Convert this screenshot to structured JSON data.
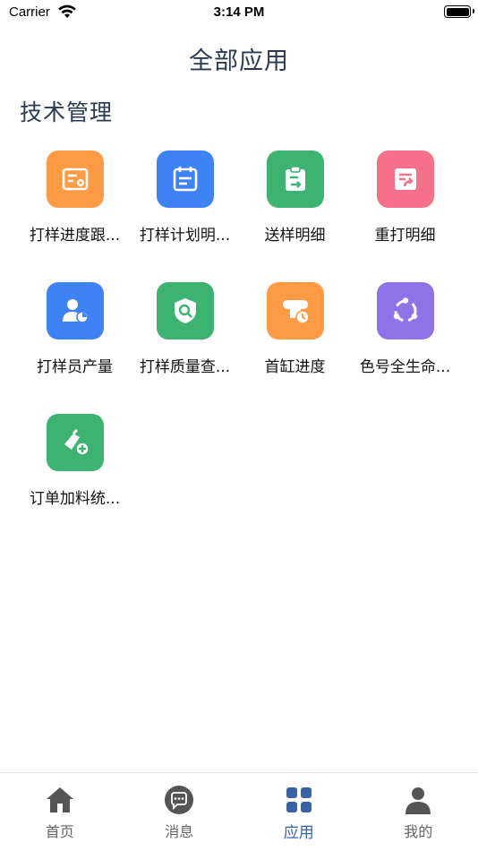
{
  "status_bar": {
    "carrier": "Carrier",
    "time": "3:14 PM"
  },
  "header": {
    "title": "全部应用"
  },
  "section": {
    "title": "技术管理"
  },
  "apps": [
    {
      "label": "打样进度跟...",
      "icon": "progress-tracking-icon",
      "color": "#FF9A45"
    },
    {
      "label": "打样计划明...",
      "icon": "calendar-plan-icon",
      "color": "#3E82F7"
    },
    {
      "label": "送样明细",
      "icon": "clipboard-send-icon",
      "color": "#3CB371"
    },
    {
      "label": "重打明细",
      "icon": "redo-document-icon",
      "color": "#F7708A"
    },
    {
      "label": "打样员产量",
      "icon": "user-chart-icon",
      "color": "#3E82F7"
    },
    {
      "label": "打样质量查...",
      "icon": "quality-search-icon",
      "color": "#3CB371"
    },
    {
      "label": "首缸进度",
      "icon": "vat-clock-icon",
      "color": "#FF9A45"
    },
    {
      "label": "色号全生命...",
      "icon": "lifecycle-icon",
      "color": "#8E72E8"
    },
    {
      "label": "订单加料统...",
      "icon": "add-material-icon",
      "color": "#3CB371"
    }
  ],
  "tabs": [
    {
      "label": "首页",
      "icon": "home-icon",
      "active": false
    },
    {
      "label": "消息",
      "icon": "message-icon",
      "active": false
    },
    {
      "label": "应用",
      "icon": "apps-grid-icon",
      "active": true
    },
    {
      "label": "我的",
      "icon": "profile-icon",
      "active": false
    }
  ],
  "colors": {
    "accent": "#3A62A6",
    "tab_inactive": "#555555"
  }
}
